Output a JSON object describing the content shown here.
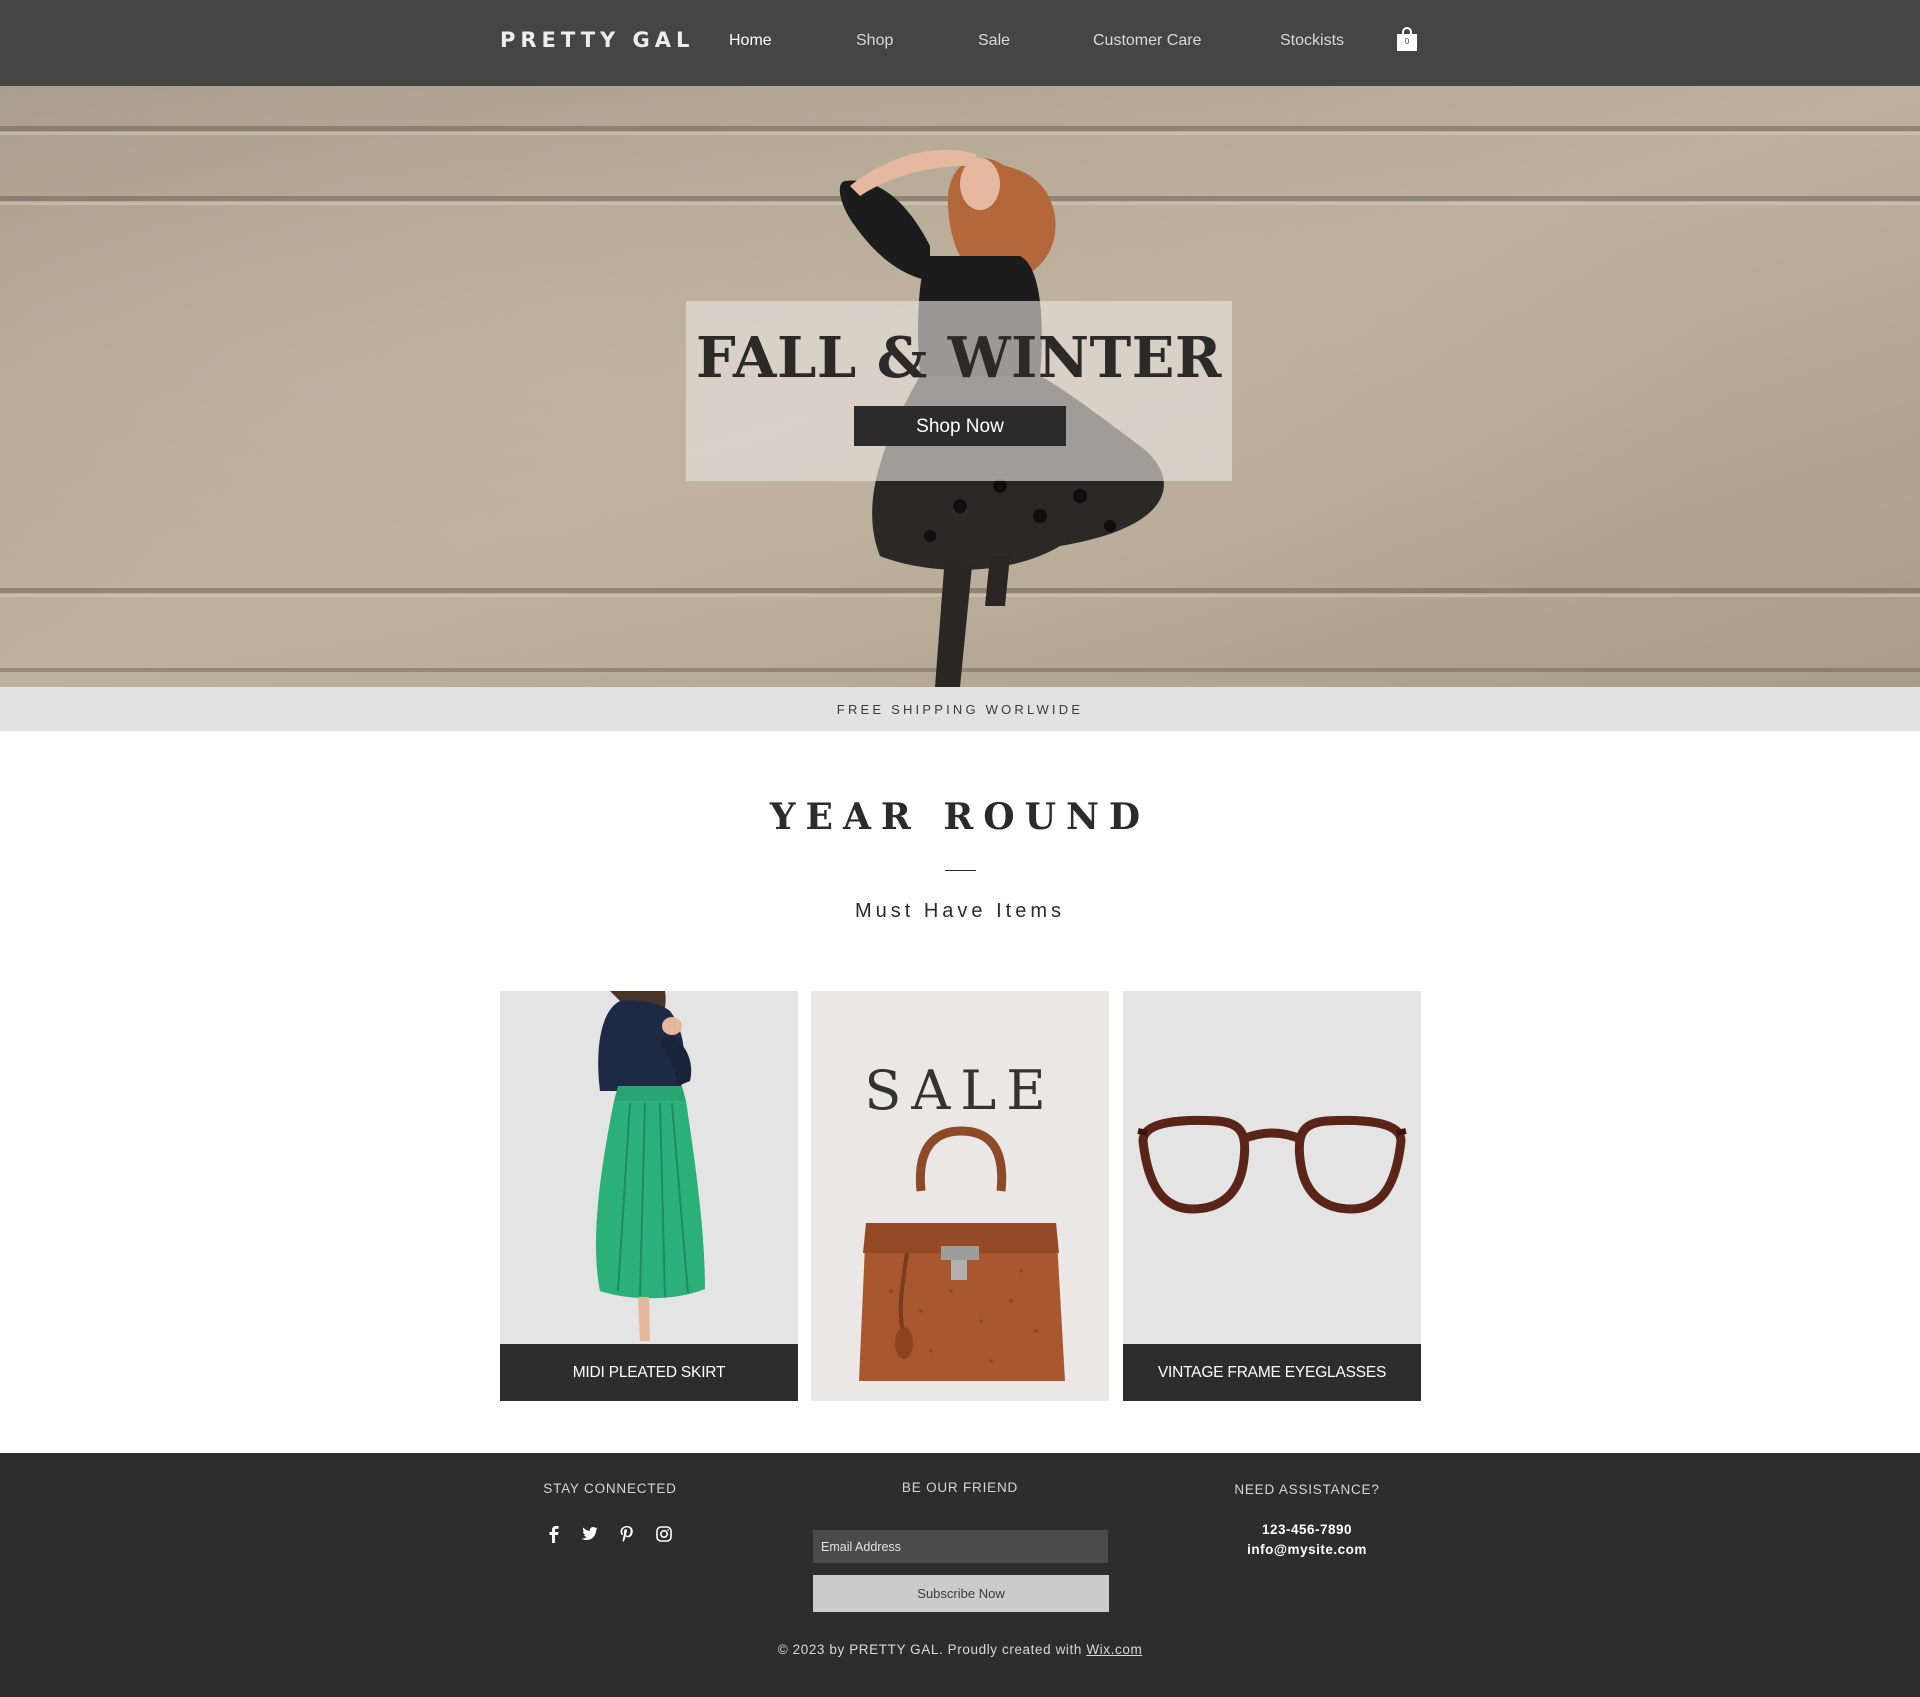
{
  "header": {
    "logo": "PRETTY GAL",
    "nav": [
      {
        "label": "Home",
        "active": true
      },
      {
        "label": "Shop"
      },
      {
        "label": "Sale"
      },
      {
        "label": "Customer Care"
      },
      {
        "label": "Stockists"
      }
    ],
    "cart_count": "0",
    "cart_icon": "shopping-bag-icon"
  },
  "hero": {
    "title": "FALL & WINTER",
    "button_label": "Shop Now"
  },
  "shipping_banner": "FREE SHIPPING WORLWIDE",
  "collection": {
    "title": "YEAR ROUND",
    "subtitle": "Must Have Items",
    "cards": [
      {
        "label": "MIDI PLEATED SKIRT"
      },
      {
        "title": "SALE"
      },
      {
        "label": "VINTAGE FRAME EYEGLASSES"
      }
    ]
  },
  "footer": {
    "stay_connected": "STAY CONNECTED",
    "social_icons": [
      "facebook-icon",
      "twitter-icon",
      "pinterest-icon",
      "instagram-icon"
    ],
    "be_our_friend": "BE OUR FRIEND",
    "email_placeholder": "Email Address",
    "subscribe_label": "Subscribe Now",
    "need_assistance": "NEED ASSISTANCE?",
    "phone": "123-456-7890",
    "email": "info@mysite.com",
    "copyright": "© 2023 by PRETTY GAL. Proudly created with",
    "copyright_link": "Wix.com"
  },
  "colors": {
    "header_bg": "#464546",
    "footer_bg": "#2d2d2e",
    "shipping_bar_bg": "#e2e2e2",
    "dark_button": "#2b2b2b"
  }
}
